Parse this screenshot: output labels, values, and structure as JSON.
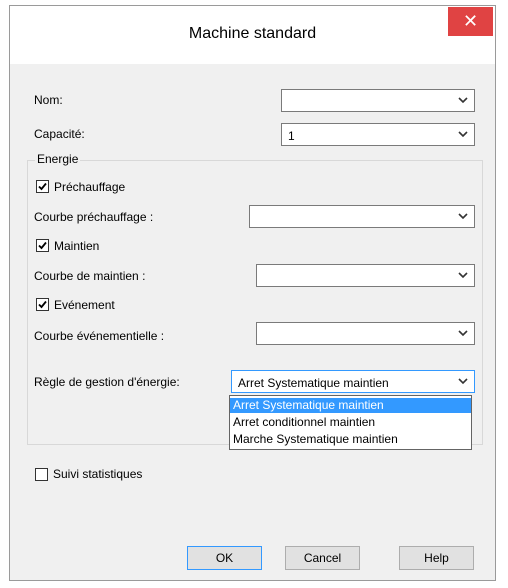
{
  "window": {
    "title": "Machine standard",
    "close_label": "✕"
  },
  "fields": {
    "nom": {
      "label": "Nom:",
      "value": ""
    },
    "capacite": {
      "label": "Capacité:",
      "value": "1"
    }
  },
  "energie": {
    "legend": "Energie",
    "prechauffage": {
      "label": "Préchauffage",
      "checked": true
    },
    "courbe_prechauffage": {
      "label": "Courbe préchauffage :",
      "value": ""
    },
    "maintien": {
      "label": "Maintien",
      "checked": true
    },
    "courbe_maintien": {
      "label": "Courbe de maintien :",
      "value": ""
    },
    "evenement": {
      "label": "Evénement",
      "checked": true
    },
    "courbe_evenementielle": {
      "label": "Courbe événementielle :",
      "value": ""
    },
    "regle": {
      "label": "Règle de gestion d'énergie:",
      "value": "Arret Systematique maintien",
      "options": [
        "Arret Systematique maintien",
        "Arret conditionnel maintien",
        "Marche Systematique maintien"
      ],
      "selected_index": 0
    }
  },
  "suivi": {
    "label": "Suivi statistiques",
    "checked": false
  },
  "buttons": {
    "ok": "OK",
    "cancel": "Cancel",
    "help": "Help"
  },
  "colors": {
    "close_bg": "#e04343",
    "highlight": "#3399ff"
  }
}
